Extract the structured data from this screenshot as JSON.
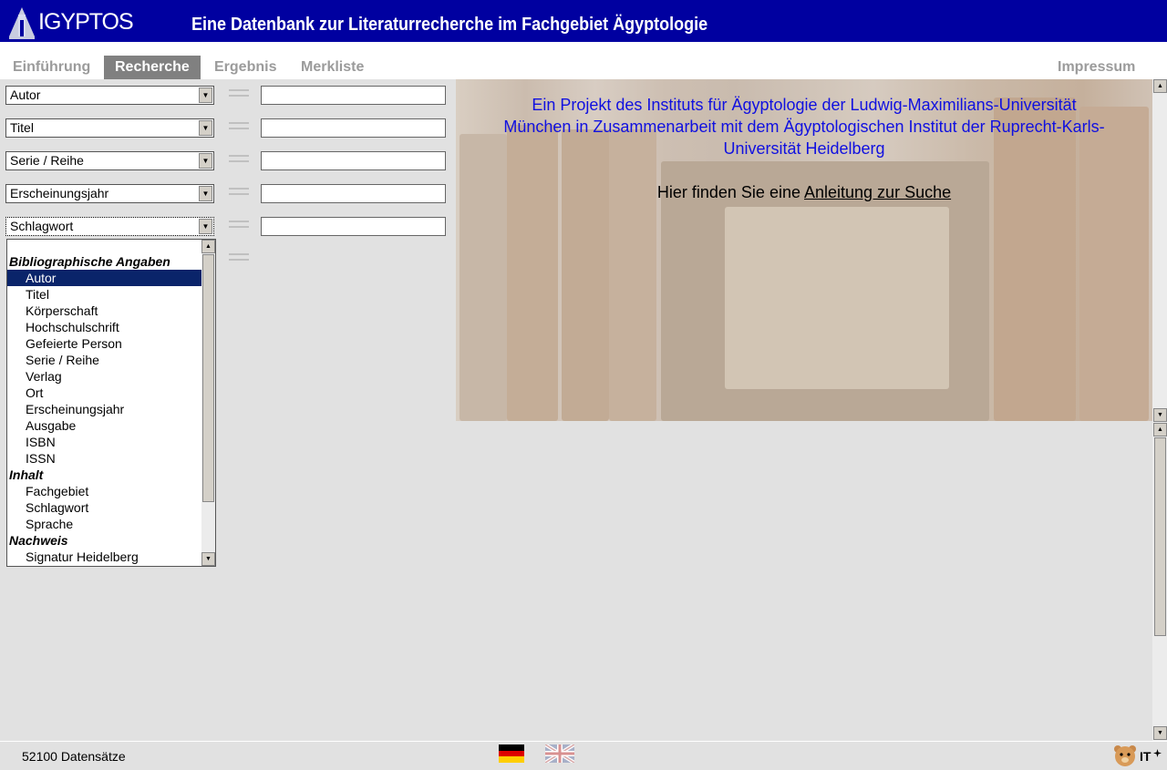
{
  "header": {
    "logo_text": "IGYPTOS",
    "title": "Eine Datenbank zur Literaturrecherche im Fachgebiet Ägyptologie"
  },
  "nav": {
    "tabs": [
      {
        "label": "Einführung",
        "active": false
      },
      {
        "label": "Recherche",
        "active": true
      },
      {
        "label": "Ergebnis",
        "active": false
      },
      {
        "label": "Merkliste",
        "active": false
      }
    ],
    "impressum": "Impressum"
  },
  "search": {
    "rows": [
      {
        "field": "Autor",
        "value": ""
      },
      {
        "field": "Titel",
        "value": ""
      },
      {
        "field": "Serie / Reihe",
        "value": ""
      },
      {
        "field": "Erscheinungsjahr",
        "value": ""
      },
      {
        "field": "Schlagwort",
        "value": ""
      }
    ]
  },
  "dropdown": {
    "group1": "Bibliographische Angaben",
    "group1_items": [
      "Autor",
      "Titel",
      "Körperschaft",
      "Hochschulschrift",
      "Gefeierte Person",
      "Serie / Reihe",
      "Verlag",
      "Ort",
      "Erscheinungsjahr",
      "Ausgabe",
      "ISBN",
      "ISSN"
    ],
    "group2": "Inhalt",
    "group2_items": [
      "Fachgebiet",
      "Schlagwort",
      "Sprache"
    ],
    "group3": "Nachweis",
    "group3_items": [
      "Signatur Heidelberg"
    ],
    "selected": "Autor"
  },
  "hero": {
    "project_line1": "Ein Projekt des Instituts für Ägyptologie der Ludwig-Maximilians-Universität",
    "project_line2": "München in Zusammenarbeit mit dem Ägyptologischen Institut der Ruprecht-Karls-",
    "project_line3": "Universität Heidelberg",
    "hint_prefix": "Hier finden Sie eine",
    "hint_link": "Anleitung zur Suche"
  },
  "status": {
    "count": "52100 Datensätze",
    "it_label": "IT"
  },
  "colors": {
    "header_bg": "#0000a0",
    "active_tab_bg": "#808080",
    "selection": "#0a246a",
    "hero_text": "#1010e0"
  }
}
